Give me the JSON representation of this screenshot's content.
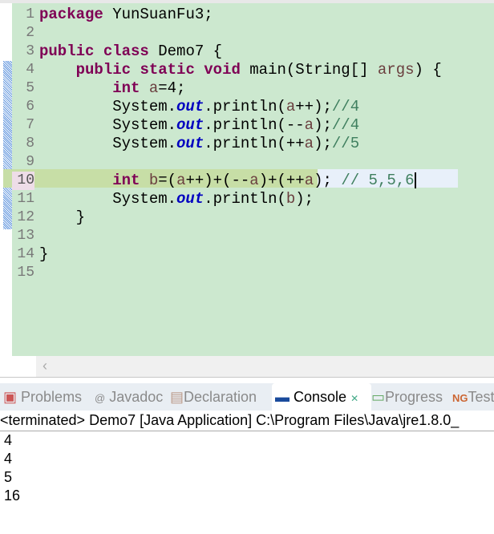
{
  "editor": {
    "lines": [
      [
        {
          "t": "package",
          "c": "kw"
        },
        {
          "t": " YunSuanFu3;"
        }
      ],
      [],
      [
        {
          "t": "public",
          "c": "kw"
        },
        {
          "t": " "
        },
        {
          "t": "class",
          "c": "kw"
        },
        {
          "t": " Demo7 {"
        }
      ],
      [
        {
          "t": "    "
        },
        {
          "t": "public",
          "c": "kw"
        },
        {
          "t": " "
        },
        {
          "t": "static",
          "c": "kw"
        },
        {
          "t": " "
        },
        {
          "t": "void",
          "c": "kw"
        },
        {
          "t": " main(String[] "
        },
        {
          "t": "args",
          "c": "var"
        },
        {
          "t": ") {"
        }
      ],
      [
        {
          "t": "        "
        },
        {
          "t": "int",
          "c": "kw"
        },
        {
          "t": " "
        },
        {
          "t": "a",
          "c": "var"
        },
        {
          "t": "=4;"
        }
      ],
      [
        {
          "t": "        System."
        },
        {
          "t": "out",
          "c": "fld"
        },
        {
          "t": ".println("
        },
        {
          "t": "a",
          "c": "var"
        },
        {
          "t": "++);"
        },
        {
          "t": "//4",
          "c": "cm"
        }
      ],
      [
        {
          "t": "        System."
        },
        {
          "t": "out",
          "c": "fld"
        },
        {
          "t": ".println(--"
        },
        {
          "t": "a",
          "c": "var"
        },
        {
          "t": ");"
        },
        {
          "t": "//4",
          "c": "cm"
        }
      ],
      [
        {
          "t": "        System."
        },
        {
          "t": "out",
          "c": "fld"
        },
        {
          "t": ".println(++"
        },
        {
          "t": "a",
          "c": "var"
        },
        {
          "t": ");"
        },
        {
          "t": "//5",
          "c": "cm"
        }
      ],
      [],
      [
        {
          "t": "        "
        },
        {
          "t": "int",
          "c": "kw"
        },
        {
          "t": " "
        },
        {
          "t": "b",
          "c": "var"
        },
        {
          "t": "=("
        },
        {
          "t": "a",
          "c": "var"
        },
        {
          "t": "++)+(--"
        },
        {
          "t": "a",
          "c": "var"
        },
        {
          "t": ")+(++"
        },
        {
          "t": "a",
          "c": "var"
        },
        {
          "t": "); "
        },
        {
          "t": "// 5,5,6",
          "c": "cm"
        }
      ],
      [
        {
          "t": "        System."
        },
        {
          "t": "out",
          "c": "fld"
        },
        {
          "t": ".println("
        },
        {
          "t": "b",
          "c": "var"
        },
        {
          "t": ");"
        }
      ],
      [
        {
          "t": "    }"
        }
      ],
      [],
      [
        {
          "t": "}"
        }
      ],
      []
    ],
    "current_line": 10,
    "scroll_left_icon": "chevron-left-icon"
  },
  "tabs": [
    {
      "label": "Problems",
      "icon": "problems-icon"
    },
    {
      "label": "Javadoc",
      "icon": "at-icon"
    },
    {
      "label": "Declaration",
      "icon": "declaration-icon"
    },
    {
      "label": "Console",
      "icon": "console-icon",
      "active": true,
      "close": "✕"
    },
    {
      "label": "Progress",
      "icon": "progress-icon"
    },
    {
      "label": "Test",
      "icon": "testng-icon"
    }
  ],
  "console": {
    "header": "<terminated> Demo7 [Java Application] C:\\Program Files\\Java\\jre1.8.0_",
    "output": [
      "4",
      "4",
      "5",
      "16"
    ]
  }
}
